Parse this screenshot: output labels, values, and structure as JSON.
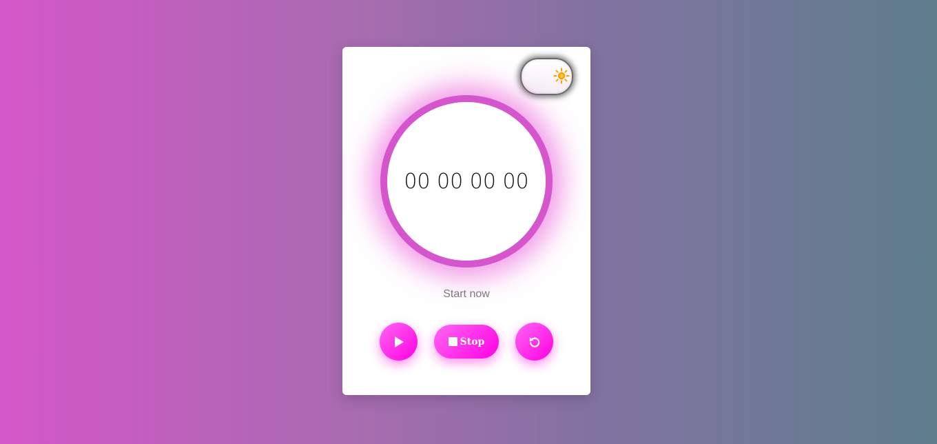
{
  "timer": {
    "display": "00 00 00 00",
    "status": "Start now"
  },
  "theme_toggle": {
    "icon": "sun-icon",
    "mode": "light"
  },
  "controls": {
    "play_icon": "play-icon",
    "stop_label": "Stop",
    "stop_icon": "stop-square-icon",
    "reset_icon": "reset-icon"
  },
  "colors": {
    "accent": "#ff00e2",
    "accent_light": "#ff66f3",
    "ring": "#d455cc",
    "sun": "#ff9d00",
    "background_start": "#d457c9",
    "background_end": "#5f7e8c"
  }
}
